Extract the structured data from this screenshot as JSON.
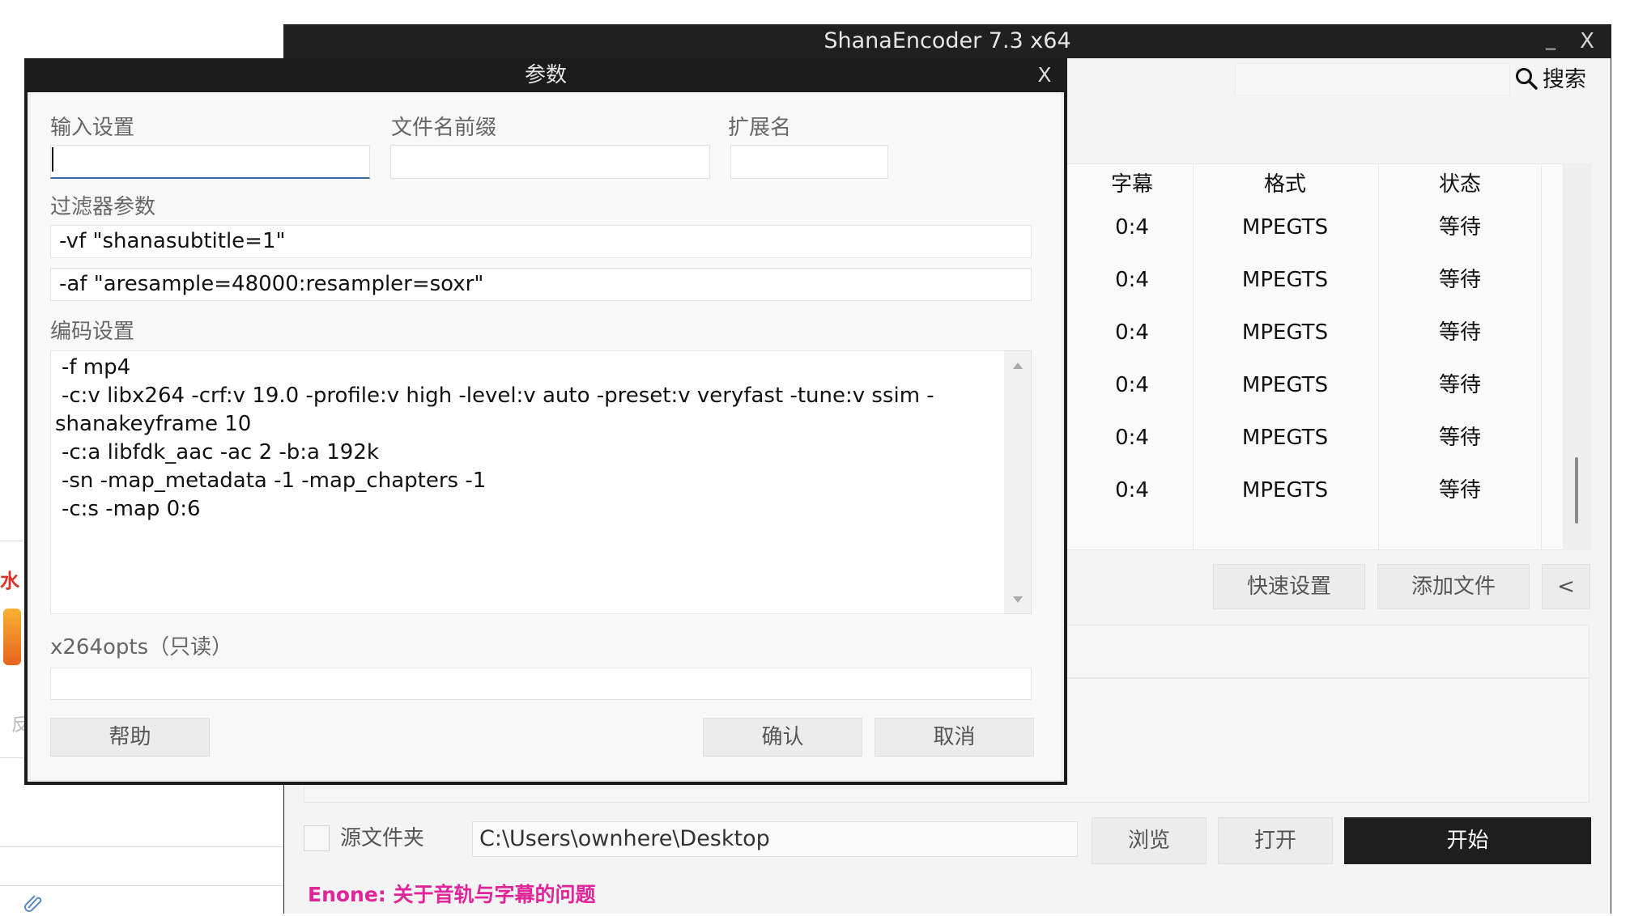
{
  "background": {
    "red_text": "水",
    "bottom_text": "反"
  },
  "main_window": {
    "title": "ShanaEncoder 7.3 x64",
    "minimize": "_",
    "close": "X",
    "search": {
      "value": "",
      "label": "搜索"
    },
    "table": {
      "headers": [
        "字幕",
        "格式",
        "状态"
      ],
      "rows": [
        [
          "0:4",
          "MPEGTS",
          "等待"
        ],
        [
          "0:4",
          "MPEGTS",
          "等待"
        ],
        [
          "0:4",
          "MPEGTS",
          "等待"
        ],
        [
          "0:4",
          "MPEGTS",
          "等待"
        ],
        [
          "0:4",
          "MPEGTS",
          "等待"
        ],
        [
          "0:4",
          "MPEGTS",
          "等待"
        ]
      ]
    },
    "buttons": {
      "quick_settings": "快速设置",
      "add_file": "添加文件",
      "collapse": "<",
      "browse": "浏览",
      "open": "打开",
      "start": "开始"
    },
    "source_folder_label": "源文件夹",
    "path": "C:\\Users\\ownhere\\Desktop",
    "footer_message": "Enone: 关于音轨与字幕的问题"
  },
  "dialog": {
    "title": "参数",
    "close": "X",
    "labels": {
      "input_settings": "输入设置",
      "filename_prefix": "文件名前缀",
      "extension": "扩展名",
      "filter_params": "过滤器参数",
      "encoding_settings": "编码设置",
      "x264opts": "x264opts（只读）"
    },
    "values": {
      "input_settings": "",
      "filename_prefix": "",
      "extension": "",
      "video_filter": "-vf \"shanasubtitle=1\"",
      "audio_filter": "-af \"aresample=48000:resampler=soxr\"",
      "x264opts": ""
    },
    "encoding_lines": [
      "-f mp4",
      "-c:v libx264 -crf:v 19.0 -profile:v high -level:v auto -preset:v veryfast -tune:v ssim -",
      "shanakeyframe 10",
      "-c:a libfdk_aac -ac 2 -b:a 192k",
      "-sn -map_metadata -1 -map_chapters -1",
      "-c:s -map 0:6"
    ],
    "buttons": {
      "help": "帮助",
      "confirm": "确认",
      "cancel": "取消"
    }
  }
}
